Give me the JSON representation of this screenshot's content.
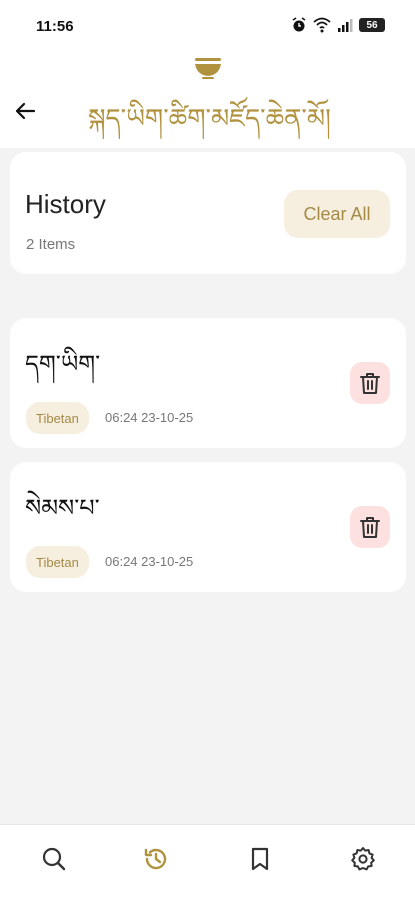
{
  "status_bar": {
    "time": "11:56",
    "battery": "56",
    "icons": [
      "alarm-icon",
      "wifi-icon",
      "signal-icon",
      "battery-icon"
    ]
  },
  "header": {
    "title": "སྐད་ཡིག་ཚིག་མཛོད་ཆེན་མོ།",
    "logo_icon": "bowl-icon",
    "back_icon": "back-arrow-icon"
  },
  "history": {
    "title": "History",
    "count": "2 Items",
    "clear_label": "Clear All"
  },
  "items": [
    {
      "word": "དག་ཡིག་",
      "language": "Tibetan",
      "time": "06:24  23-10-25"
    },
    {
      "word": "སེམས་པ་",
      "language": "Tibetan",
      "time": "06:24  23-10-25"
    }
  ],
  "nav": [
    {
      "icon": "search-icon",
      "active": false
    },
    {
      "icon": "history-icon",
      "active": true
    },
    {
      "icon": "bookmark-icon",
      "active": false
    },
    {
      "icon": "settings-icon",
      "active": false
    }
  ],
  "colors": {
    "accent": "#b0923f",
    "chip_bg": "#f6efe0",
    "delete_bg": "#fde1e1",
    "background": "#f3f3f3"
  }
}
